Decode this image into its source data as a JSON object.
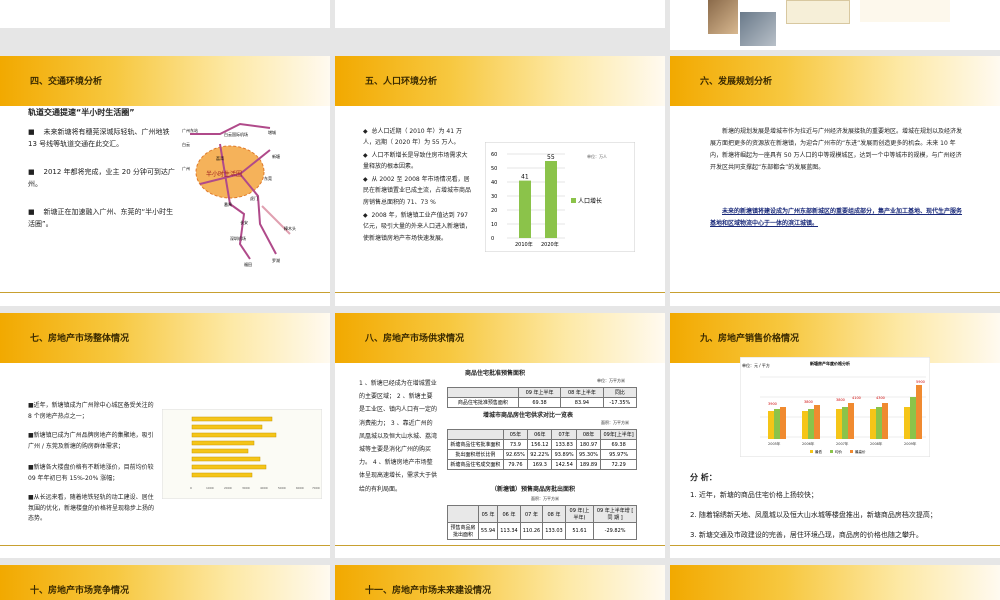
{
  "s4": {
    "title": "四、交通环境分析",
    "heading": "轨道交通提速“半小时生活圈”",
    "bullets": [
      "未来新塘将有穗莞深城际轻轨、广州地铁 13 号线等轨道交通在此交汇。",
      "2012 年都将完成，业主 20 分钟可到达广 州。",
      "新塘正在加速融入广州、东莞的“半小时生活圈”。"
    ],
    "map_center": "半小时生活圈",
    "map_labels": [
      "广州东站",
      "白云国际机场",
      "增城",
      "白云",
      "新塘",
      "广州",
      "荔湾",
      "东莞",
      "番禺",
      "长安",
      "深圳机场",
      "樟木头",
      "福田",
      "罗湖",
      "虎门"
    ]
  },
  "s5": {
    "title": "五、人口环境分析",
    "bullets": [
      "总人口近期（ 2010 年）为 41 万人，远期（ 2020 年）为 55 万人。",
      "人口不断增长是导致住房市场需求大量释放的根本因素。",
      "从 2002 至 2008 年市场情况看，居民在新塘镇置业已成主流，占增城市商品房销售总面积的 71、73 %",
      "2008 年，新塘镇工业产值达到 797 亿元，吸引大量的外来人口进入新塘镇，使新塘镇房地产市场快速发展。"
    ]
  },
  "chart_data": {
    "type": "bar",
    "categories": [
      "2010年",
      "2020年"
    ],
    "values": [
      41,
      55
    ],
    "unit": "单位：万人",
    "legend": "人口增长",
    "ylim": [
      0,
      60
    ],
    "yticks": [
      "0",
      "10",
      "20",
      "30",
      "40",
      "50",
      "60"
    ],
    "series": [
      {
        "name": "人口增长",
        "values": [
          41,
          55
        ]
      }
    ]
  },
  "s6": {
    "title": "六、发展规划分析",
    "para": "新塘的规划发展是增城市作为拉近与广州经济发展接轨的重要地区。增城在规划以及经济发展方面把更多的资源放在新塘镇，为迎合广州市的“东进”发展而创造更多的机会。未来 10 年内，新塘将崛起为一座具有 50 万人口的中等规模城区，达到一个中等城市的规模，与广州经济开发区共同支撑起“东部都会”的发展蓝图。",
    "highlight": "未来的新塘镇将建设成为广州东部新城区的重要组成部分，集产业加工基地、现代生产服务基地和区域物流中心于一体的滨江城镇。"
  },
  "s7": {
    "title": "七、房地产市场整体情况",
    "bullets": [
      "■近年，新塘镇成为广州除中心城区备受关注的 8 个房地产热点之一；",
      "■新塘镇已成为广州品牌房地产的集聚地，吸引广州 / 东莞及新塘的购房群体需求；",
      "■新塘各大楼盘价格有不断地涨价，目前均价较 09 年年初已有 15%-20% 涨幅；",
      "■从长远来看，随着地铁轻轨的动工建设、居住氛围的优化，新塘楼盘的价格将呈现稳步上扬的态势。"
    ],
    "axis": [
      "0",
      "1000",
      "2000",
      "3000",
      "4000",
      "5000",
      "6000",
      "7000"
    ]
  },
  "s8": {
    "title": "八、房地产市场供求情况",
    "left_text": "1 、新塘已经成为在增城置业的主要区域； 2 、新塘主要是工业区、镇内人口有一定的消费能力； 3 、靠近广州的凤凰城以及恒大山水城、荔湾城等主要是消化广州的购买力。 4 、新塘房地产市场整体呈现高速增长，需求大于供给的有利局面。",
    "t1_title": "商品住宅批准预售面积",
    "t1_unit": "单位：万平方米",
    "t1_head": [
      "",
      "09 年上半年",
      "08 年上半年",
      "同比"
    ],
    "t1_row": [
      "商品住宅批准预售面积",
      "69.38",
      "83.94",
      "-17.35%"
    ],
    "t2_title": "增城市商品房住宅供求对比一览表",
    "t2_unit": "面积：万平方米",
    "t2_head": [
      "",
      "05年",
      "06年",
      "07年",
      "08年",
      "09年[上半年]"
    ],
    "t2_rows": [
      [
        "新塘商品住宅批准面积",
        "73.9",
        "156.12",
        "133.83",
        "180.97",
        "69.38"
      ],
      [
        "批出面积增长比例",
        "92.65%",
        "92.22%",
        "93.89%",
        "95.30%",
        "95.97%"
      ],
      [
        "新塘商品住宅成交面积",
        "79.76",
        "169.3",
        "142.54",
        "189.89",
        "72.29"
      ]
    ],
    "t3_title": "（新塘镇）预售商品房批出面积",
    "t3_unit": "面积：万平方米",
    "t3_head": [
      "",
      "05 年",
      "06 年",
      "07 年",
      "08 年",
      "09 年(上半年)",
      "09 年上半年增 [ 同 期 ]"
    ],
    "t3_row": [
      "预售商品房批出面积",
      "55.94",
      "113.34",
      "110.26",
      "133.03",
      "51.61",
      "-29.82%"
    ]
  },
  "s9": {
    "title": "九、房地产销售价格情况",
    "chart_title": "新塘房产年度价格分析",
    "chart_unit": "单位：元 / 平方",
    "labels": [
      "3900",
      "3800",
      "3800",
      "4100",
      "4300",
      "5900"
    ],
    "years": [
      "2005年",
      "2006年",
      "2007年",
      "2008年",
      "2009年"
    ],
    "legend": [
      "最低",
      "均价",
      "最高价"
    ],
    "analysis_title": "分 析：",
    "analysis": [
      "1. 近年，新塘的商品住宅价格上扬较快；",
      "2. 随着锦绣新天地、凤凰城以及恒大山水城等楼盘推出，新塘商品房档次提高；",
      "3. 新塘交通及市政建设的完善，居住环境凸现，商品房的价格也随之攀升。"
    ]
  },
  "s10": {
    "title": "十、房地产市场竞争情况"
  },
  "s11": {
    "title": "十一、房地产市场未来建设情况"
  },
  "colors": {
    "accent": "#f2a900",
    "bar_green": "#8bc34a",
    "bar_yellow": "#f5c518"
  }
}
